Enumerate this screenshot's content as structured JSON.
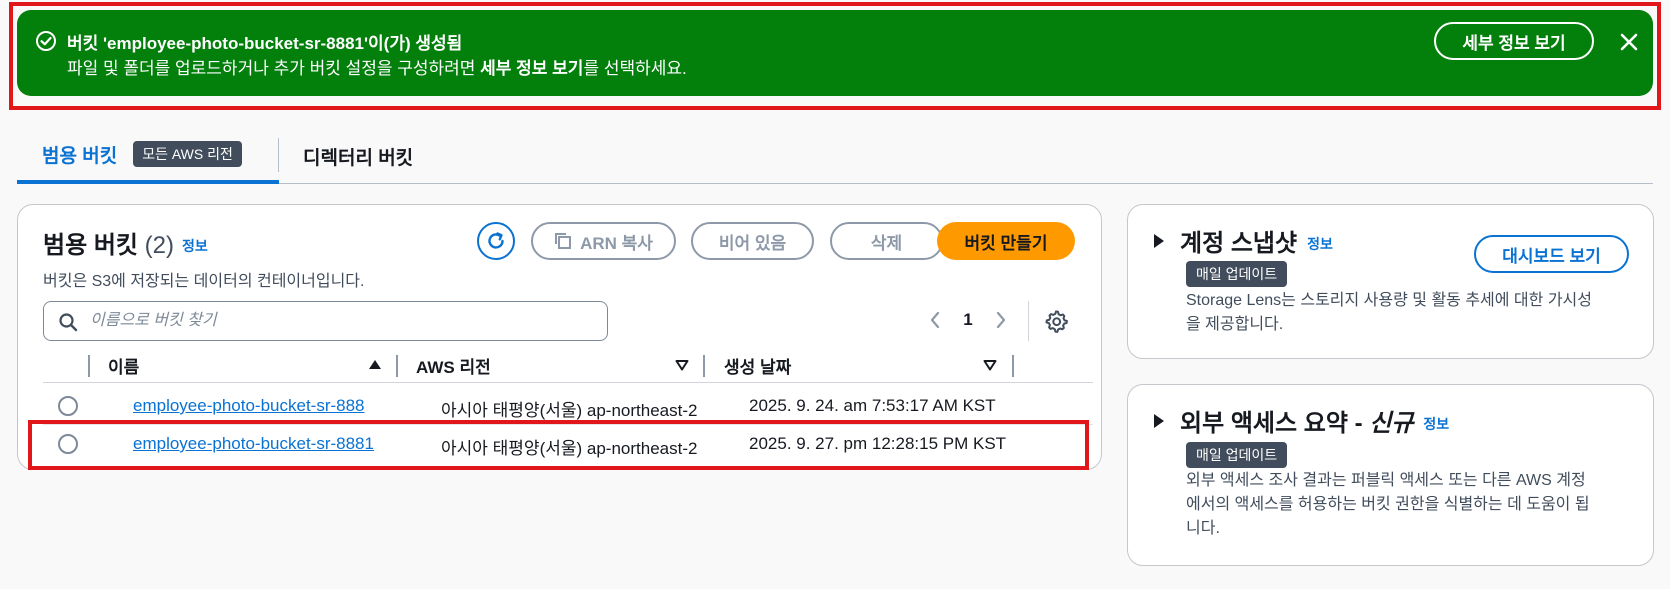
{
  "flash": {
    "title": "버킷 'employee-photo-bucket-sr-8881'이(가) 생성됨",
    "desc_prefix": "파일 및 폴더를 업로드하거나 추가 버킷 설정을 구성하려면 ",
    "desc_bold": "세부 정보 보기",
    "desc_suffix": "를 선택하세요.",
    "details_button": "세부 정보 보기",
    "icon": "check-circle-icon",
    "close_icon": "close-icon",
    "bg_color": "#037f0c"
  },
  "tabs": [
    {
      "label": "범용 버킷",
      "badge": "모든 AWS 리전",
      "selected": true
    },
    {
      "label": "디렉터리 버킷",
      "selected": false
    }
  ],
  "buckets": {
    "title": "범용 버킷",
    "count": "(2)",
    "info": "정보",
    "description": "버킷은 S3에 저장되는 데이터의 컨테이너입니다.",
    "buttons": {
      "refresh_icon": "refresh-icon",
      "copy_arn": "ARN 복사",
      "empty": "비어 있음",
      "delete": "삭제",
      "create": "버킷 만들기"
    },
    "search_placeholder": "이름으로 버킷 찾기",
    "page": "1",
    "columns": {
      "name": "이름",
      "region": "AWS 리전",
      "created": "생성 날짜"
    },
    "rows": [
      {
        "name": "employee-photo-bucket-sr-888",
        "region": "아시아 태평양(서울) ap-northeast-2",
        "created": "2025. 9. 24. am 7:53:17 AM KST"
      },
      {
        "name": "employee-photo-bucket-sr-8881",
        "region": "아시아 태평양(서울) ap-northeast-2",
        "created": "2025. 9. 27. pm 12:28:15 PM KST"
      }
    ]
  },
  "lens": {
    "title": "계정 스냅샷",
    "info": "정보",
    "badge": "매일 업데이트",
    "description_line1": "Storage Lens는 스토리지 사용량 및 활동 추세에 대한 가시성",
    "description_line2": "을 제공합니다.",
    "dashboard_button": "대시보드 보기"
  },
  "access": {
    "title_prefix": "외부 액세스 요약 - ",
    "title_new": "신규",
    "info": "정보",
    "badge": "매일 업데이트",
    "description_line1": "외부 액세스 조사 결과는 퍼블릭 액세스 또는 다른 AWS 계정",
    "description_line2": "에서의 액세스를 허용하는 버킷 권한을 식별하는 데 도움이 됩",
    "description_line3": "니다."
  },
  "colors": {
    "accent": "#0972d3",
    "primary_button": "#ff9900",
    "highlight": "#e0161b"
  }
}
